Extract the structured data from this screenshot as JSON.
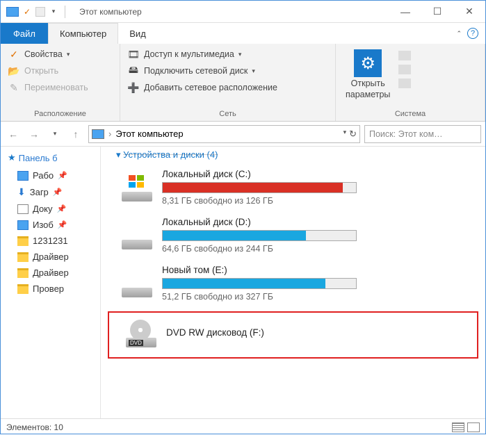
{
  "titlebar": {
    "title": "Этот компьютер"
  },
  "tabs": {
    "file": "Файл",
    "computer": "Компьютер",
    "view": "Вид"
  },
  "ribbon": {
    "location_group": "Расположение",
    "properties": "Свойства",
    "open": "Открыть",
    "rename": "Переименовать",
    "network_group": "Сеть",
    "media_access": "Доступ к мультимедиа",
    "connect_netdrive": "Подключить сетевой диск",
    "add_netlocation": "Добавить сетевое расположение",
    "system_group": "Система",
    "open_settings_line1": "Открыть",
    "open_settings_line2": "параметры"
  },
  "nav": {
    "breadcrumb": "Этот компьютер",
    "search_placeholder": "Поиск: Этот ком…"
  },
  "sidebar": {
    "quick": "Панель б",
    "items": [
      {
        "label": "Рабо",
        "icon": "desktop",
        "pinned": true
      },
      {
        "label": "Загр",
        "icon": "downloads",
        "pinned": true
      },
      {
        "label": "Доку",
        "icon": "document",
        "pinned": true
      },
      {
        "label": "Изоб",
        "icon": "image",
        "pinned": true
      },
      {
        "label": "1231231",
        "icon": "folder",
        "pinned": false
      },
      {
        "label": "Драйвер",
        "icon": "folder",
        "pinned": false
      },
      {
        "label": "Драйвер",
        "icon": "folder",
        "pinned": false
      },
      {
        "label": "Провер",
        "icon": "folder",
        "pinned": false
      }
    ]
  },
  "main": {
    "section_header": "Устройства и диски (4)",
    "drives": [
      {
        "name": "Локальный диск (C:)",
        "stat": "8,31 ГБ свободно из 126 ГБ",
        "fill_pct": 93,
        "color": "#d93025",
        "type": "os"
      },
      {
        "name": "Локальный диск (D:)",
        "stat": "64,6 ГБ свободно из 244 ГБ",
        "fill_pct": 74,
        "color": "#1aa7e0",
        "type": "hdd"
      },
      {
        "name": "Новый том (E:)",
        "stat": "51,2 ГБ свободно из 327 ГБ",
        "fill_pct": 84,
        "color": "#1aa7e0",
        "type": "hdd"
      },
      {
        "name": "DVD RW дисковод (F:)",
        "stat": "",
        "fill_pct": 0,
        "color": "",
        "type": "dvd",
        "highlight": true
      }
    ]
  },
  "statusbar": {
    "count_label": "Элементов: 10"
  }
}
